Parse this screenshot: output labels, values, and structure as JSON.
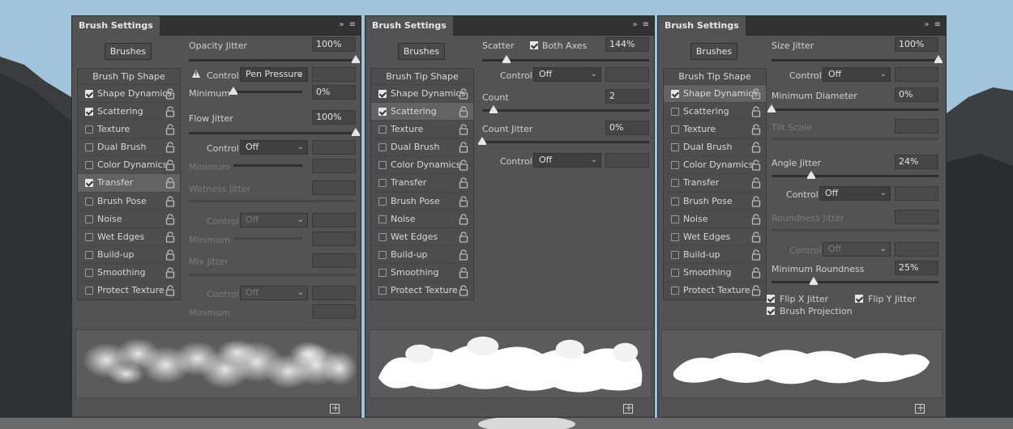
{
  "panels": [
    {
      "tab": "Brush Settings",
      "brushes_button": "Brushes",
      "sidebar_head": "Brush Tip Shape",
      "sidebar": [
        {
          "label": "Shape Dynamics",
          "checked": true
        },
        {
          "label": "Scattering",
          "checked": true
        },
        {
          "label": "Texture",
          "checked": false
        },
        {
          "label": "Dual Brush",
          "checked": false
        },
        {
          "label": "Color Dynamics",
          "checked": false
        },
        {
          "label": "Transfer",
          "checked": true,
          "selected": true
        },
        {
          "label": "Brush Pose",
          "checked": false
        },
        {
          "label": "Noise",
          "checked": false
        },
        {
          "label": "Wet Edges",
          "checked": false
        },
        {
          "label": "Build-up",
          "checked": false
        },
        {
          "label": "Smoothing",
          "checked": false
        },
        {
          "label": "Protect Texture",
          "checked": false
        }
      ],
      "content": {
        "opacity_jitter_label": "Opacity Jitter",
        "opacity_jitter_value": "100%",
        "opacity_jitter_level": 1.0,
        "control_label": "Control:",
        "control_value": "Pen Pressure",
        "minimum_label": "Minimum",
        "minimum_value": "0%",
        "minimum_level": 0.0,
        "flow_jitter_label": "Flow Jitter",
        "flow_jitter_value": "100%",
        "flow_jitter_level": 1.0,
        "control2_label": "Control:",
        "control2_value": "Off",
        "minimum2_label": "Minimum",
        "wetness_jitter_label": "Wetness Jitter",
        "control3_label": "Control:",
        "control3_value": "Off",
        "minimum3_label": "Minimum",
        "mix_jitter_label": "Mix Jitter",
        "control4_label": "Control:",
        "control4_value": "Off",
        "minimum4_label": "Minimum"
      }
    },
    {
      "tab": "Brush Settings",
      "brushes_button": "Brushes",
      "sidebar_head": "Brush Tip Shape",
      "sidebar": [
        {
          "label": "Shape Dynamics",
          "checked": true
        },
        {
          "label": "Scattering",
          "checked": true,
          "selected": true
        },
        {
          "label": "Texture",
          "checked": false
        },
        {
          "label": "Dual Brush",
          "checked": false
        },
        {
          "label": "Color Dynamics",
          "checked": false
        },
        {
          "label": "Transfer",
          "checked": false
        },
        {
          "label": "Brush Pose",
          "checked": false
        },
        {
          "label": "Noise",
          "checked": false
        },
        {
          "label": "Wet Edges",
          "checked": false
        },
        {
          "label": "Build-up",
          "checked": false
        },
        {
          "label": "Smoothing",
          "checked": false
        },
        {
          "label": "Protect Texture",
          "checked": false
        }
      ],
      "content": {
        "scatter_label": "Scatter",
        "both_axes_label": "Both Axes",
        "scatter_value": "144%",
        "scatter_level": 0.144,
        "control_label": "Control:",
        "control_value": "Off",
        "count_label": "Count",
        "count_value": "2",
        "count_level": 0.07,
        "count_jitter_label": "Count Jitter",
        "count_jitter_value": "0%",
        "count_jitter_level": 0.0,
        "control2_label": "Control:",
        "control2_value": "Off"
      }
    },
    {
      "tab": "Brush Settings",
      "brushes_button": "Brushes",
      "sidebar_head": "Brush Tip Shape",
      "sidebar": [
        {
          "label": "Shape Dynamics",
          "checked": true,
          "selected": true
        },
        {
          "label": "Scattering",
          "checked": false
        },
        {
          "label": "Texture",
          "checked": false
        },
        {
          "label": "Dual Brush",
          "checked": false
        },
        {
          "label": "Color Dynamics",
          "checked": false
        },
        {
          "label": "Transfer",
          "checked": false
        },
        {
          "label": "Brush Pose",
          "checked": false
        },
        {
          "label": "Noise",
          "checked": false
        },
        {
          "label": "Wet Edges",
          "checked": false
        },
        {
          "label": "Build-up",
          "checked": false
        },
        {
          "label": "Smoothing",
          "checked": false
        },
        {
          "label": "Protect Texture",
          "checked": false
        }
      ],
      "content": {
        "size_jitter_label": "Size Jitter",
        "size_jitter_value": "100%",
        "size_jitter_level": 1.0,
        "control_label": "Control:",
        "control_value": "Off",
        "min_diameter_label": "Minimum Diameter",
        "min_diameter_value": "0%",
        "min_diameter_level": 0.0,
        "tilt_scale_label": "Tilt Scale",
        "angle_jitter_label": "Angle Jitter",
        "angle_jitter_value": "24%",
        "angle_jitter_level": 0.24,
        "control2_label": "Control:",
        "control2_value": "Off",
        "roundness_jitter_label": "Roundness Jitter",
        "control3_label": "Control:",
        "control3_value": "Off",
        "min_roundness_label": "Minimum Roundness",
        "min_roundness_value": "25%",
        "min_roundness_level": 0.25,
        "flip_x_label": "Flip X Jitter",
        "flip_y_label": "Flip Y Jitter",
        "brush_projection_label": "Brush Projection"
      }
    }
  ]
}
